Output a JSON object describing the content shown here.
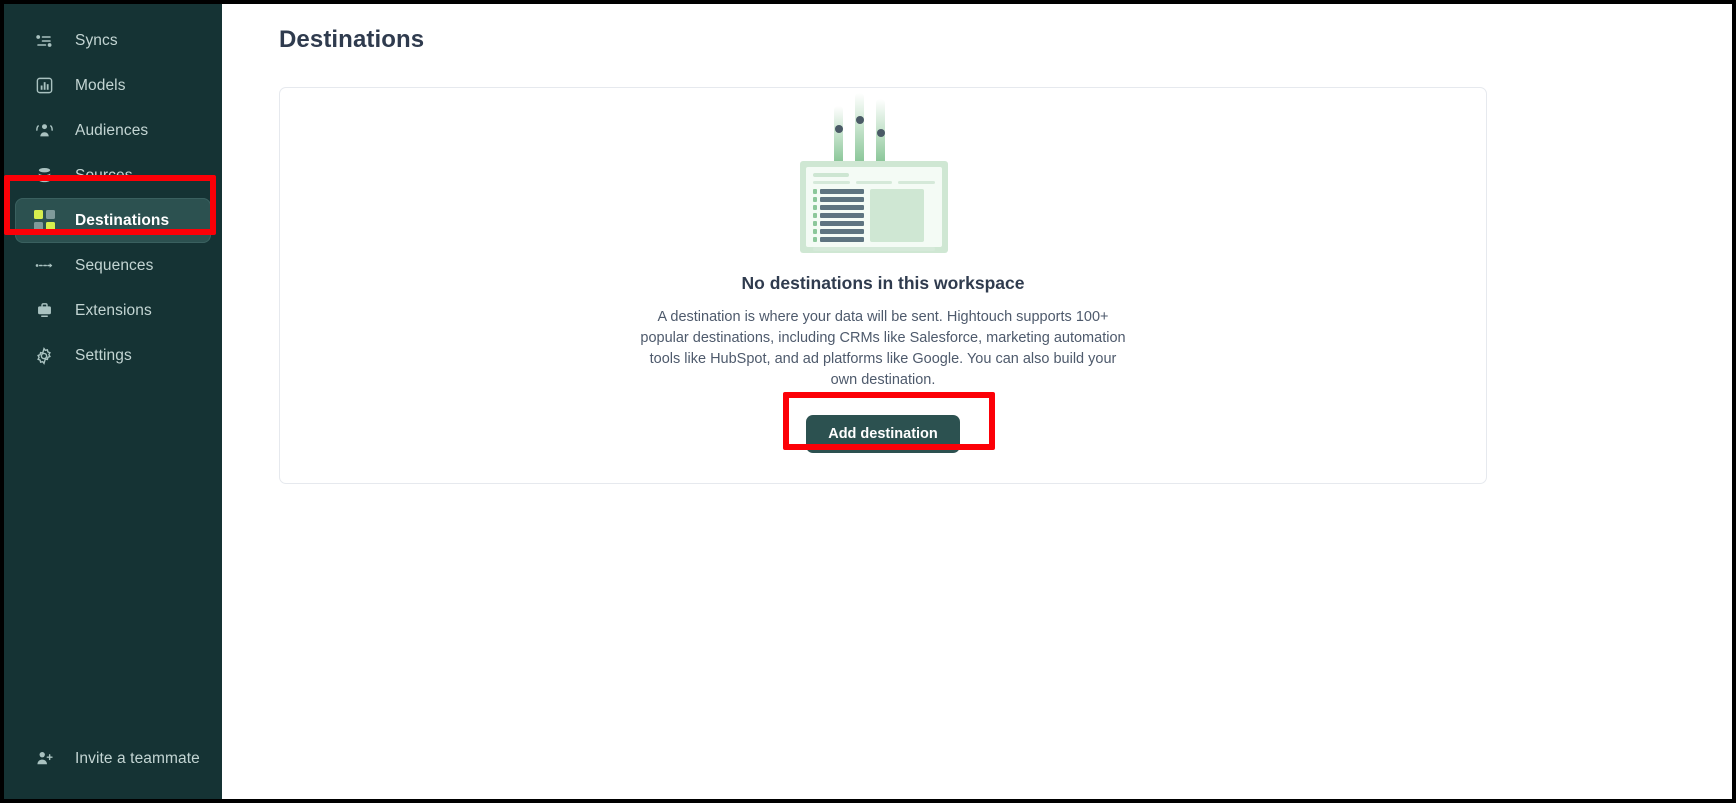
{
  "sidebar": {
    "items": [
      {
        "label": "Syncs",
        "icon": "syncs-icon",
        "active": false
      },
      {
        "label": "Models",
        "icon": "models-icon",
        "active": false
      },
      {
        "label": "Audiences",
        "icon": "audiences-icon",
        "active": false
      },
      {
        "label": "Sources",
        "icon": "sources-icon",
        "active": false
      },
      {
        "label": "Destinations",
        "icon": "destinations-icon",
        "active": true
      },
      {
        "label": "Sequences",
        "icon": "sequences-icon",
        "active": false
      },
      {
        "label": "Extensions",
        "icon": "extensions-icon",
        "active": false
      },
      {
        "label": "Settings",
        "icon": "settings-icon",
        "active": false
      }
    ],
    "footer": {
      "label": "Invite a teammate",
      "icon": "invite-user-icon"
    },
    "background_color": "#153334",
    "active_item_color": "#2c5150"
  },
  "main": {
    "page_title": "Destinations",
    "empty_state": {
      "illustration": "destination-window-illustration",
      "heading": "No destinations in this workspace",
      "body": "A destination is where your data will be sent. Hightouch supports 100+ popular destinations, including CRMs like Salesforce, marketing automation tools like HubSpot, and ad platforms like Google. You can also build your own destination.",
      "button_label": "Add destination",
      "button_color": "#2c5150"
    }
  },
  "annotations": {
    "highlight_color": "#fc0007",
    "boxes": [
      {
        "name": "sidebar-destinations-highlight",
        "target": "Destinations"
      },
      {
        "name": "add-destination-highlight",
        "target": "Add destination"
      }
    ]
  }
}
